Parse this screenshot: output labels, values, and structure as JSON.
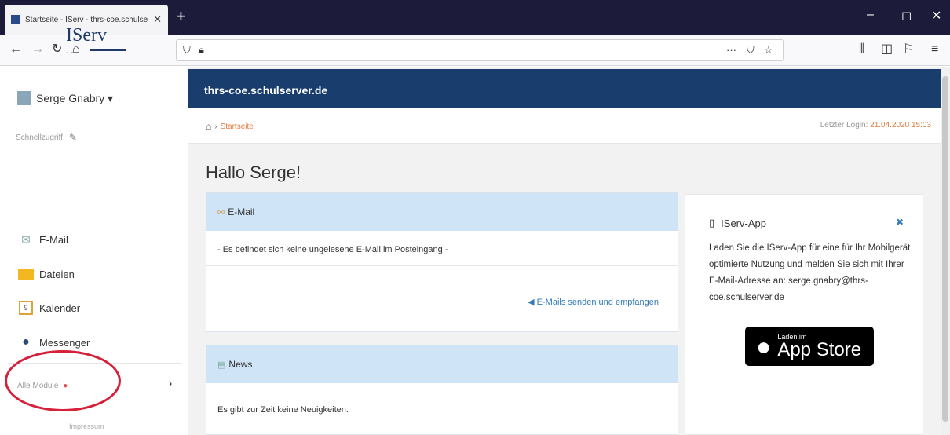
{
  "browser": {
    "tab_title": "Startseite - IServ - thrs-coe.schulserver.de",
    "tab_close": "✕",
    "new_tab": "+",
    "window_controls": {
      "minimize": "–",
      "maximize": "◻",
      "close": "✕"
    },
    "url_placeholder": ""
  },
  "colors": {
    "header_blue": "#193d6c",
    "panel_head": "#cfe4f6",
    "accent_orange": "#e07a3a",
    "annotation_red": "#d6213a"
  },
  "sidebar": {
    "logo": "IServ",
    "user_name": "Serge Gnabry ▾",
    "quick_access": "Schnellzugriff",
    "items": [
      {
        "label": "E-Mail",
        "icon": "mail-icon"
      },
      {
        "label": "Dateien",
        "icon": "folder-icon"
      },
      {
        "label": "Kalender",
        "icon": "calendar-icon"
      },
      {
        "label": "Messenger",
        "icon": "messenger-icon"
      }
    ],
    "all_modules": "Alle Module",
    "impressum": "Impressum"
  },
  "header": {
    "site": "thrs-coe.schulserver.de",
    "breadcrumb_current": "Startseite",
    "last_login_label": "Letzter Login:",
    "last_login_value": "21.04.2020 15:03"
  },
  "main": {
    "greeting": "Hallo Serge!",
    "email_panel": {
      "title": "E-Mail",
      "message": "- Es befindet sich keine ungelesene E-Mail im Posteingang -",
      "link": "E-Mails senden und empfangen"
    },
    "news_panel": {
      "title": "News",
      "message": "Es gibt zur Zeit keine Neuigkeiten."
    }
  },
  "app_box": {
    "title": "IServ-App",
    "text": "Laden Sie die IServ-App für eine für Ihr Mobilgerät optimierte Nutzung und melden Sie sich mit Ihrer E-Mail-Adresse an: serge.gnabry@thrs-coe.schulserver.de",
    "store_small": "Laden im",
    "store_big": "App Store"
  }
}
